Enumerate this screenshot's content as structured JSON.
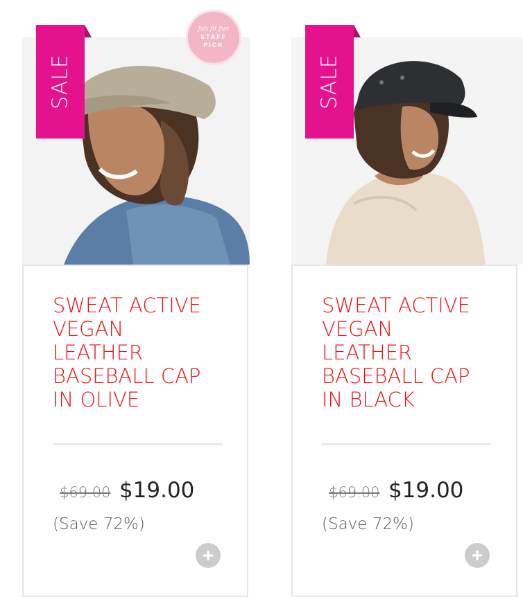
{
  "products": [
    {
      "ribbon": "SALE",
      "badge": {
        "brand": "fab fit fun",
        "line1": "STAFF",
        "line2": "PICK"
      },
      "title": "SWEAT ACTIVE VEGAN LEATHER BASEBALL CAP IN OLIVE",
      "old_price": "$69.00",
      "price": "$19.00",
      "save": "(Save 72%)",
      "image": "woman-wearing-olive-cap",
      "cap_color": "#b8ad97"
    },
    {
      "ribbon": "SALE",
      "title": "SWEAT ACTIVE VEGAN LEATHER BASEBALL CAP IN BLACK",
      "old_price": "$69.00",
      "price": "$19.00",
      "save": "(Save 72%)",
      "image": "woman-wearing-black-cap",
      "cap_color": "#2e2f33"
    }
  ],
  "colors": {
    "sale_ribbon": "#e5128e",
    "title": "#ee1111",
    "badge": "#f3b6c8",
    "add_button": "#cccccc"
  },
  "icons": {
    "add": "plus-circle-icon"
  }
}
